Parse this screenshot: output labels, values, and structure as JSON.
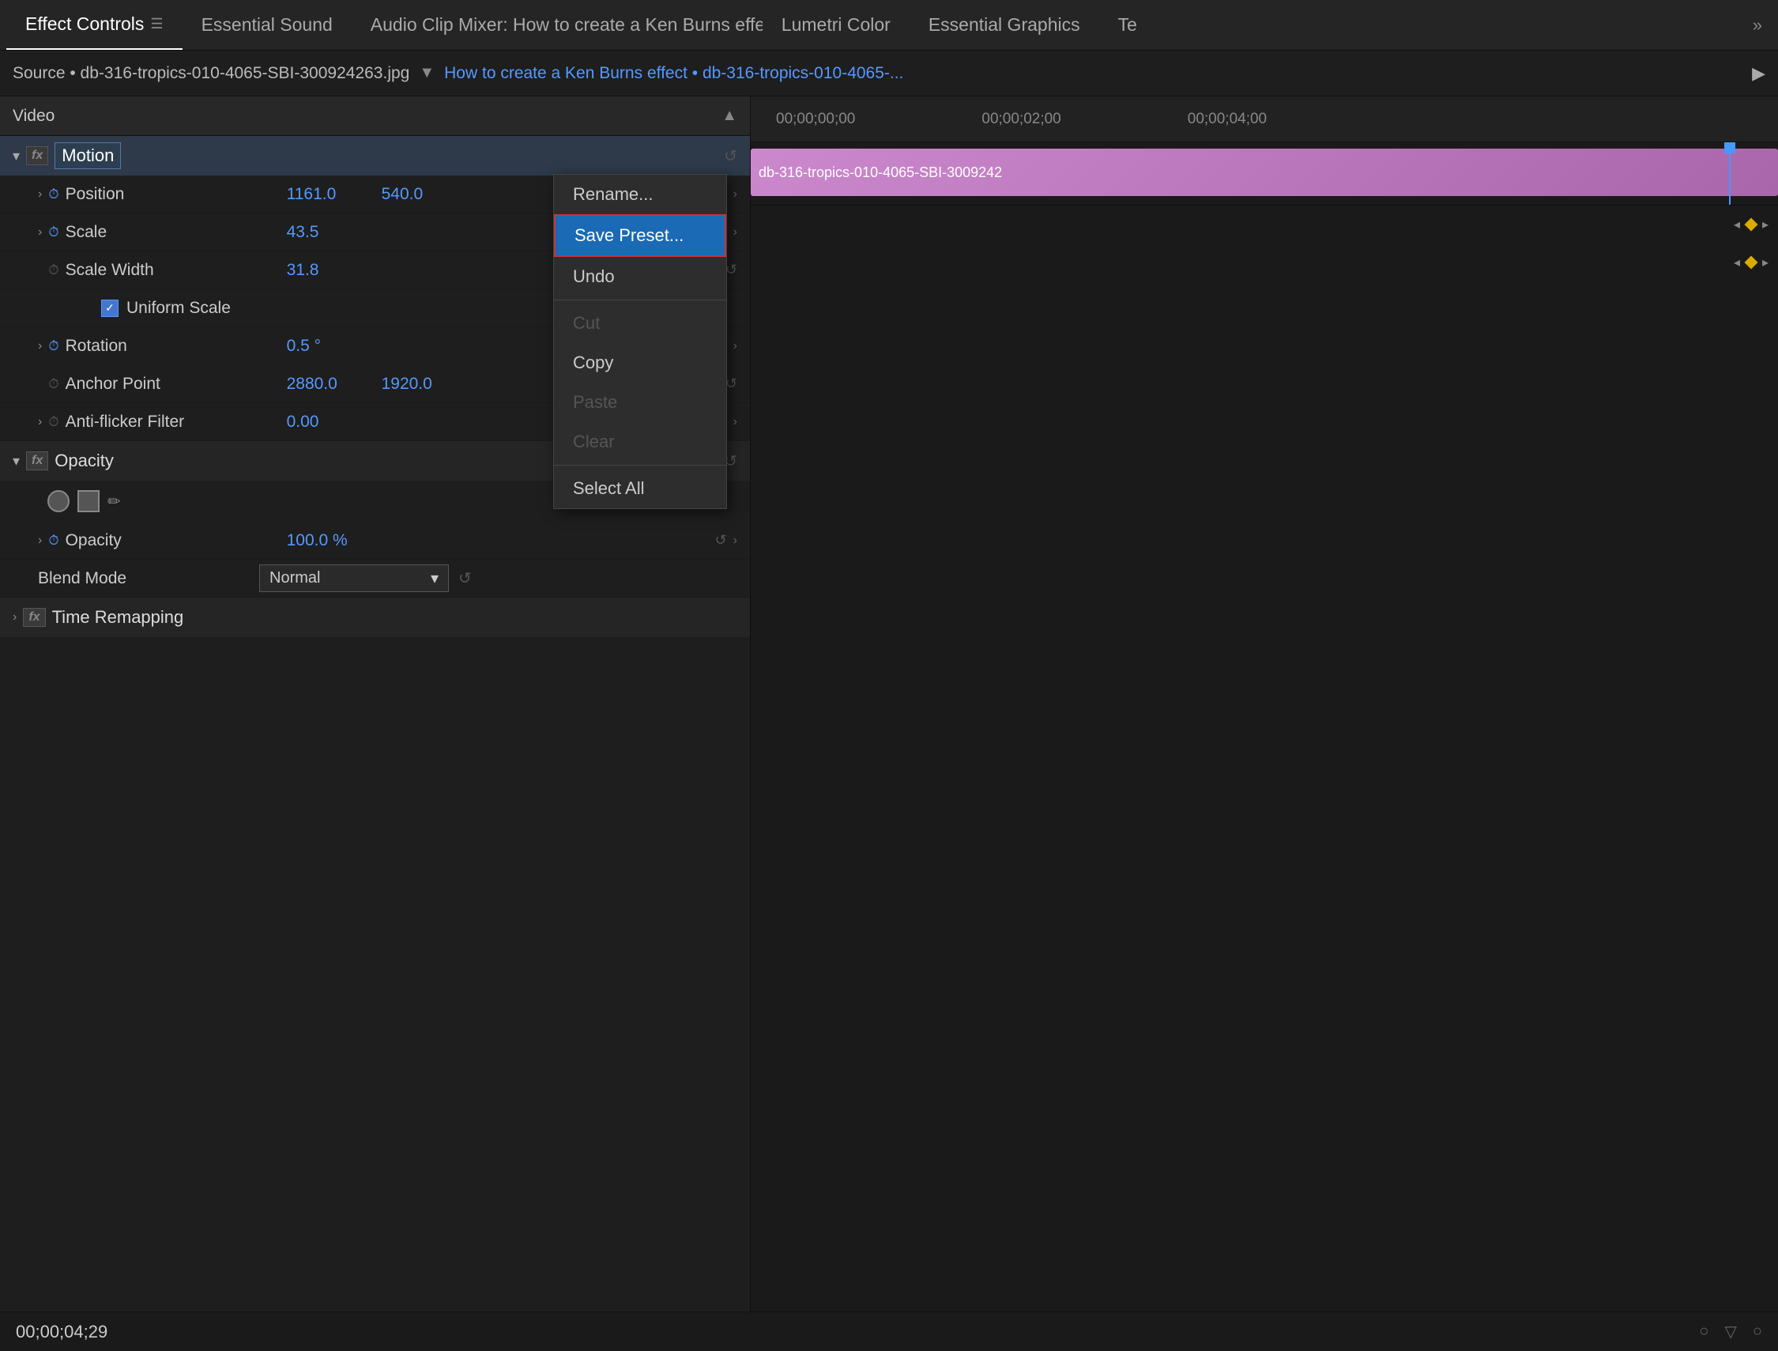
{
  "tabs": [
    {
      "label": "Effect Controls",
      "active": true,
      "menu": true
    },
    {
      "label": "Essential Sound",
      "active": false
    },
    {
      "label": "Audio Clip Mixer: How to create a Ken Burns effect",
      "active": false
    },
    {
      "label": "Lumetri Color",
      "active": false
    },
    {
      "label": "Essential Graphics",
      "active": false
    },
    {
      "label": "Te",
      "active": false
    }
  ],
  "source": {
    "prefix": "Source • db-316-tropics-010-4065-SBI-300924263.jpg",
    "link": "How to create a Ken Burns effect • db-316-tropics-010-4065-..."
  },
  "timeline": {
    "times": [
      "00;00;00;00",
      "00;00;02;00",
      "00;00;04;00"
    ],
    "clip_name": "db-316-tropics-010-4065-SBI-3009242"
  },
  "panel": {
    "section_label": "Video"
  },
  "motion": {
    "label": "Motion",
    "fx_label": "fx",
    "properties": [
      {
        "name": "Position",
        "values": [
          "1161.0",
          "540.0"
        ],
        "has_stopwatch": true,
        "chevron": true
      },
      {
        "name": "Scale",
        "values": [
          "43.5"
        ],
        "has_stopwatch": true,
        "chevron": true
      },
      {
        "name": "Scale Width",
        "values": [
          "31.8"
        ],
        "has_stopwatch": false,
        "chevron": false
      },
      {
        "name": "Rotation",
        "values": [
          "0.5 °"
        ],
        "has_stopwatch": true,
        "chevron": true
      },
      {
        "name": "Anchor Point",
        "values": [
          "2880.0",
          "1920.0"
        ],
        "has_stopwatch": true,
        "chevron": false
      },
      {
        "name": "Anti-flicker Filter",
        "values": [
          "0.00"
        ],
        "has_stopwatch": true,
        "chevron": true
      }
    ],
    "uniform_scale": true,
    "uniform_scale_label": "Uniform Scale"
  },
  "opacity": {
    "label": "Opacity",
    "fx_label": "fx",
    "properties": [
      {
        "name": "Opacity",
        "values": [
          "100.0 %"
        ],
        "has_stopwatch": true,
        "chevron": true
      }
    ],
    "blend_mode": {
      "label": "Blend Mode",
      "value": "Normal"
    }
  },
  "time_remapping": {
    "label": "Time Remapping",
    "fx_label": "fx"
  },
  "context_menu": {
    "items": [
      {
        "label": "Rename...",
        "highlighted": false,
        "disabled": false,
        "separator_after": false
      },
      {
        "label": "Save Preset...",
        "highlighted": true,
        "disabled": false,
        "separator_after": false
      },
      {
        "label": "Undo",
        "highlighted": false,
        "disabled": false,
        "separator_after": false
      },
      {
        "label": "Cut",
        "highlighted": false,
        "disabled": true,
        "separator_after": false
      },
      {
        "label": "Copy",
        "highlighted": false,
        "disabled": false,
        "separator_after": false
      },
      {
        "label": "Paste",
        "highlighted": false,
        "disabled": true,
        "separator_after": false
      },
      {
        "label": "Clear",
        "highlighted": false,
        "disabled": true,
        "separator_after": true
      },
      {
        "label": "Select All",
        "highlighted": false,
        "disabled": false,
        "separator_after": false
      }
    ]
  },
  "status_bar": {
    "timecode": "00;00;04;29"
  },
  "colors": {
    "accent_blue": "#5599ff",
    "highlight_red": "#cc2222",
    "clip_pink": "#cc88cc"
  }
}
